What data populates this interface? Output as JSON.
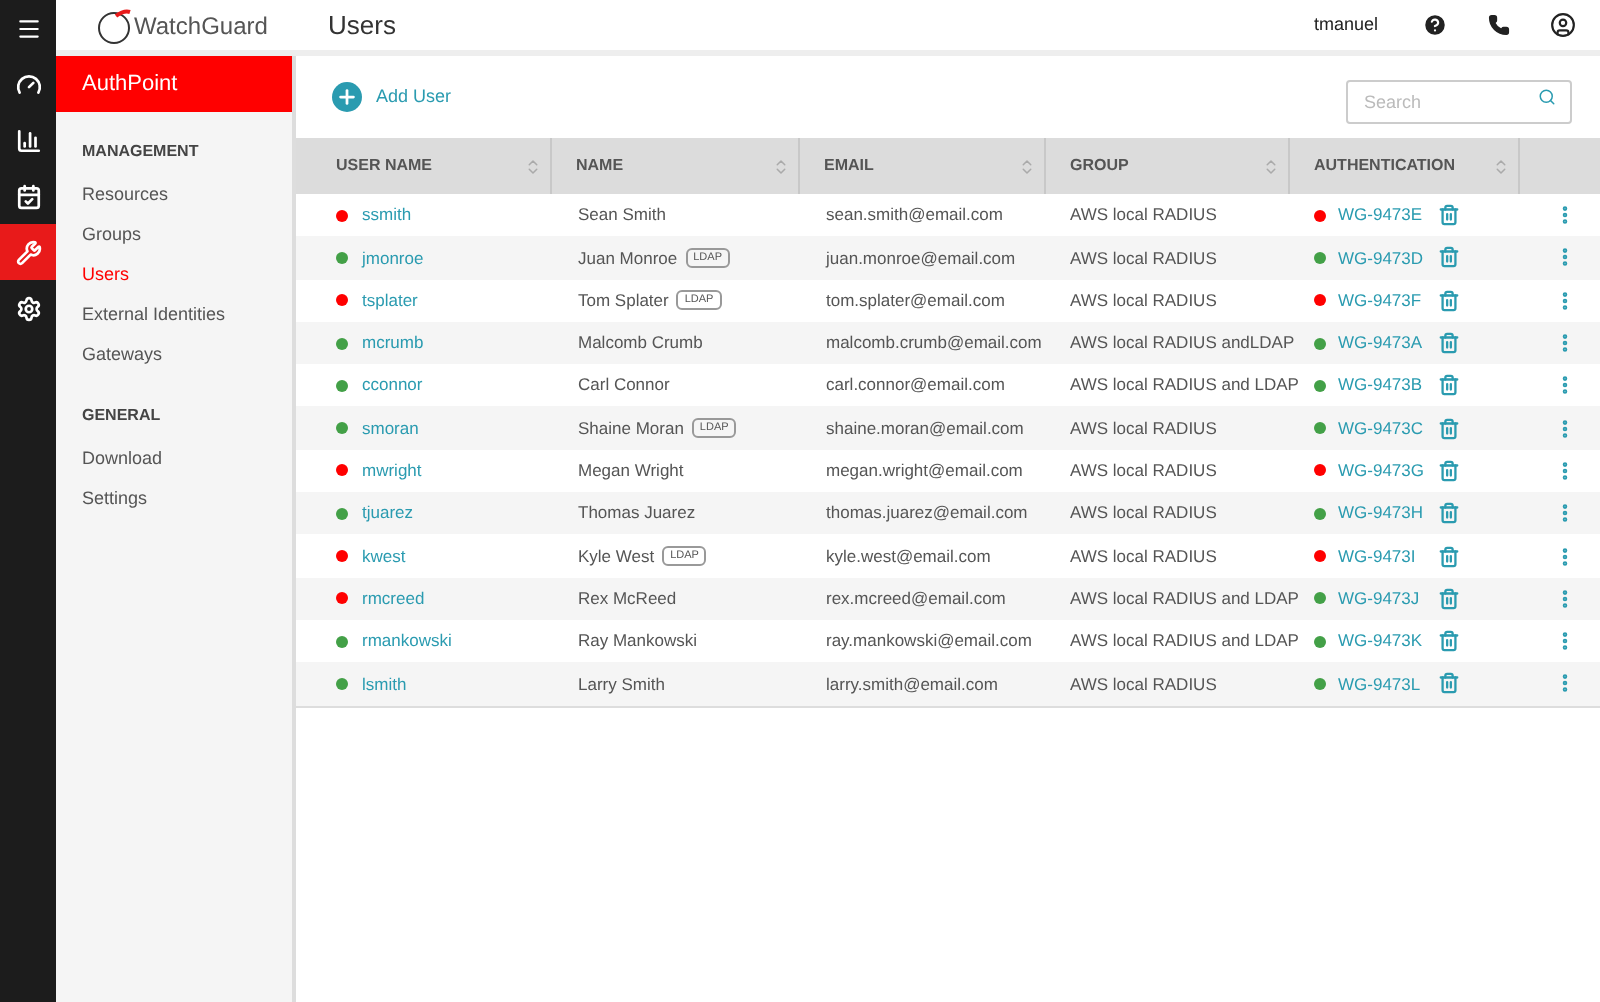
{
  "rail": [
    {
      "kind": "dashboard",
      "selected": false
    },
    {
      "kind": "reports",
      "selected": false
    },
    {
      "kind": "tasks",
      "selected": false
    },
    {
      "kind": "tools",
      "selected": true
    },
    {
      "kind": "settings",
      "selected": false
    }
  ],
  "logo": "WatchGuard",
  "page_title": "Users",
  "user": "tmanuel",
  "sidebar": {
    "product": "AuthPoint",
    "sections": [
      {
        "title": "MANAGEMENT",
        "items": [
          {
            "label": "Resources",
            "selected": false
          },
          {
            "label": "Groups",
            "selected": false
          },
          {
            "label": "Users",
            "selected": true
          },
          {
            "label": "External Identities",
            "selected": false
          },
          {
            "label": "Gateways",
            "selected": false
          }
        ]
      },
      {
        "title": "GENERAL",
        "items": [
          {
            "label": "Download",
            "selected": false
          },
          {
            "label": "Settings",
            "selected": false
          }
        ]
      }
    ]
  },
  "add_button": "Add User",
  "search": {
    "placeholder": "Search"
  },
  "table": {
    "columns": [
      "USER NAME",
      "NAME",
      "EMAIL",
      "GROUP",
      "AUTHENTICATION"
    ],
    "rows": [
      {
        "username": "ssmith",
        "active": false,
        "name": "Sean Smith",
        "email": "sean.smith@email.com",
        "group": "AWS local RADIUS",
        "token_active": false,
        "token": "WG-9473E"
      },
      {
        "username": "jmonroe",
        "active": true,
        "name": "Juan Monroe",
        "badge": "LDAP",
        "email": "juan.monroe@email.com",
        "group": "AWS local RADIUS",
        "token_active": true,
        "token": "WG-9473D"
      },
      {
        "username": "tsplater",
        "active": false,
        "name": "Tom Splater",
        "badge": "LDAP",
        "email": "tom.splater@email.com",
        "group": "AWS local RADIUS",
        "token_active": false,
        "token": "WG-9473F"
      },
      {
        "username": "mcrumb",
        "active": true,
        "name": "Malcomb Crumb",
        "email": "malcomb.crumb@email.com",
        "group": "AWS local RADIUS andLDAP",
        "token_active": true,
        "token": "WG-9473A"
      },
      {
        "username": "cconnor",
        "active": true,
        "name": "Carl Connor",
        "email": "carl.connor@email.com",
        "group": "AWS local RADIUS and LDAP",
        "token_active": true,
        "token": "WG-9473B"
      },
      {
        "username": "smoran",
        "active": true,
        "name": "Shaine Moran",
        "badge": "LDAP",
        "email": "shaine.moran@email.com",
        "group": "AWS local RADIUS",
        "token_active": true,
        "token": "WG-9473C"
      },
      {
        "username": "mwright",
        "active": false,
        "name": "Megan Wright",
        "email": "megan.wright@email.com",
        "group": "AWS local RADIUS",
        "token_active": false,
        "token": "WG-9473G"
      },
      {
        "username": "tjuarez",
        "active": true,
        "name": "Thomas Juarez",
        "email": "thomas.juarez@email.com",
        "group": "AWS local RADIUS",
        "token_active": true,
        "token": "WG-9473H"
      },
      {
        "username": "kwest",
        "active": false,
        "name": "Kyle West",
        "badge": "LDAP",
        "email": "kyle.west@email.com",
        "group": "AWS local RADIUS",
        "token_active": false,
        "token": "WG-9473I"
      },
      {
        "username": "rmcreed",
        "active": false,
        "name": "Rex McReed",
        "email": "rex.mcreed@email.com",
        "group": "AWS local RADIUS and LDAP",
        "token_active": true,
        "token": "WG-9473J"
      },
      {
        "username": "rmankowski",
        "active": true,
        "name": "Ray Mankowski",
        "email": "ray.mankowski@email.com",
        "group": "AWS local RADIUS and LDAP",
        "token_active": true,
        "token": "WG-9473K"
      },
      {
        "username": "lsmith",
        "active": true,
        "name": "Larry Smith",
        "email": "larry.smith@email.com",
        "group": "AWS local RADIUS",
        "token_active": true,
        "token": "WG-9473L"
      }
    ]
  }
}
